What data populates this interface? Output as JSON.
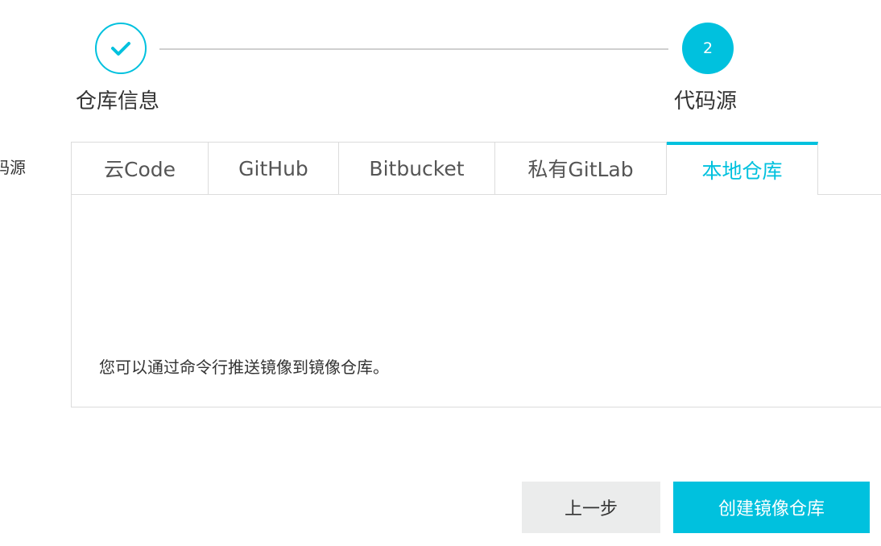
{
  "stepper": {
    "steps": [
      {
        "label": "仓库信息",
        "status": "completed",
        "icon": "check-icon"
      },
      {
        "label": "代码源",
        "status": "active",
        "number": "2"
      }
    ]
  },
  "form": {
    "side_label": "码源"
  },
  "tabs": [
    {
      "label": "云Code",
      "active": false
    },
    {
      "label": "GitHub",
      "active": false
    },
    {
      "label": "Bitbucket",
      "active": false
    },
    {
      "label": "私有GitLab",
      "active": false
    },
    {
      "label": "本地仓库",
      "active": true
    }
  ],
  "panel": {
    "text": "您可以通过命令行推送镜像到镜像仓库。"
  },
  "buttons": {
    "prev_label": "上一步",
    "create_label": "创建镜像仓库"
  },
  "colors": {
    "accent": "#00c1de",
    "secondary_button_bg": "#ebecec",
    "border": "#dcdcdc"
  }
}
